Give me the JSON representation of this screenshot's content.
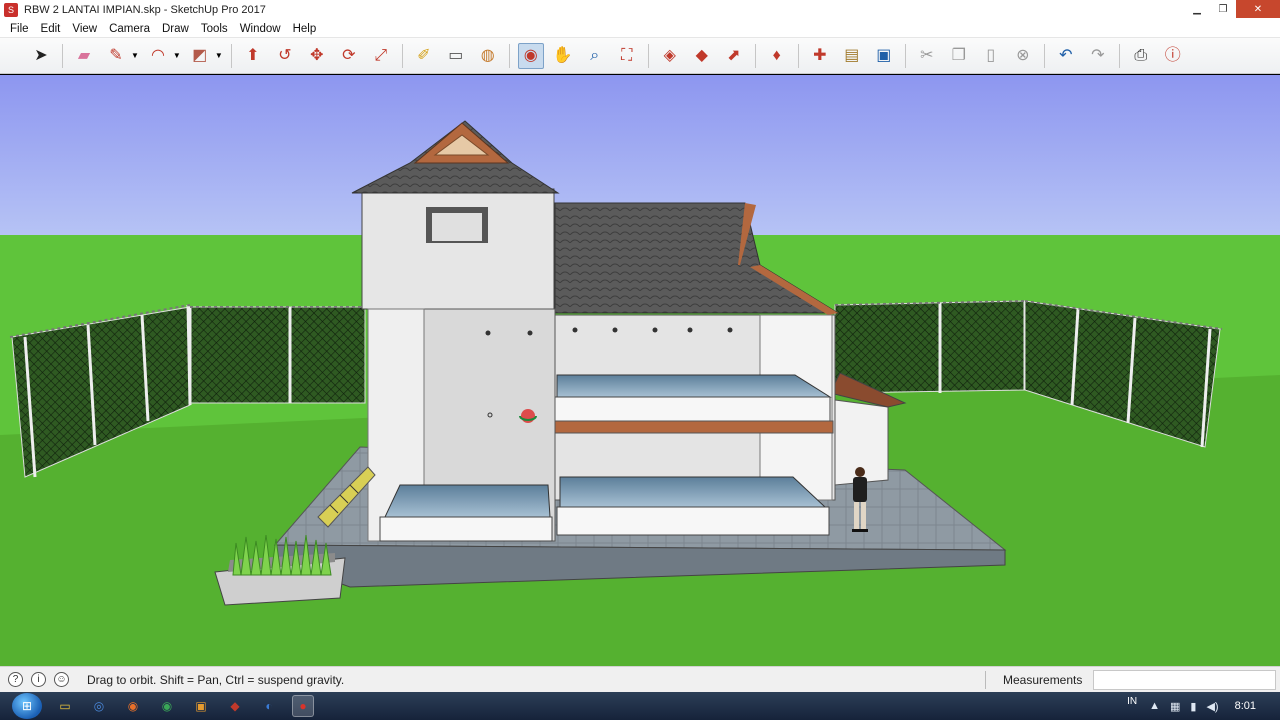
{
  "window": {
    "title": "RBW 2 LANTAI IMPIAN.skp - SketchUp Pro 2017",
    "app_icon": "sketchup-icon",
    "controls": [
      "minimize-icon",
      "maximize-icon",
      "close-icon"
    ]
  },
  "menu": {
    "items": [
      "File",
      "Edit",
      "View",
      "Camera",
      "Draw",
      "Tools",
      "Window",
      "Help"
    ]
  },
  "toolbar": {
    "tools": [
      {
        "name": "select-icon",
        "glyph": "➤",
        "color": "#222222"
      },
      {
        "name": "eraser-icon",
        "glyph": "▰",
        "color": "#d9739b"
      },
      {
        "name": "pencil-icon",
        "glyph": "✎",
        "color": "#c0392b"
      },
      {
        "name": "arc-icon",
        "glyph": "◠",
        "color": "#c0392b"
      },
      {
        "name": "rectangle-icon",
        "glyph": "◩",
        "color": "#b35a4a"
      },
      {
        "name": "push-pull-icon",
        "glyph": "⬆",
        "color": "#c0392b"
      },
      {
        "name": "follow-me-icon",
        "glyph": "↺",
        "color": "#c0392b"
      },
      {
        "name": "move-icon",
        "glyph": "✥",
        "color": "#c0392b"
      },
      {
        "name": "rotate-icon",
        "glyph": "⟳",
        "color": "#c0392b"
      },
      {
        "name": "scale-icon",
        "glyph": "⤢",
        "color": "#c0392b"
      },
      {
        "name": "tape-measure-icon",
        "glyph": "✐",
        "color": "#d4a017"
      },
      {
        "name": "text-icon",
        "glyph": "▭",
        "color": "#555555"
      },
      {
        "name": "paint-bucket-icon",
        "glyph": "◍",
        "color": "#c47a2c"
      },
      {
        "name": "orbit-icon",
        "glyph": "◉",
        "color": "#c0392b"
      },
      {
        "name": "pan-icon",
        "glyph": "✋",
        "color": "#d4a017"
      },
      {
        "name": "zoom-icon",
        "glyph": "⌕",
        "color": "#1f5fa8"
      },
      {
        "name": "zoom-extents-icon",
        "glyph": "⛶",
        "color": "#c0392b"
      },
      {
        "name": "warehouse-icon",
        "glyph": "◈",
        "color": "#c0392b"
      },
      {
        "name": "extension-icon",
        "glyph": "◆",
        "color": "#c0392b"
      },
      {
        "name": "share-model-icon",
        "glyph": "⬈",
        "color": "#c0392b"
      },
      {
        "name": "ruby-icon",
        "glyph": "♦",
        "color": "#c0392b"
      },
      {
        "name": "new-file-icon",
        "glyph": "✚",
        "color": "#c0392b"
      },
      {
        "name": "open-folder-icon",
        "glyph": "▤",
        "color": "#a07a2c"
      },
      {
        "name": "save-icon",
        "glyph": "▣",
        "color": "#1f5fa8"
      },
      {
        "name": "cut-icon",
        "glyph": "✂",
        "color": "#999999"
      },
      {
        "name": "copy-icon",
        "glyph": "❐",
        "color": "#999999"
      },
      {
        "name": "paste-icon",
        "glyph": "▯",
        "color": "#999999"
      },
      {
        "name": "delete-icon",
        "glyph": "⊗",
        "color": "#999999"
      },
      {
        "name": "undo-icon",
        "glyph": "↶",
        "color": "#1f5fa8"
      },
      {
        "name": "redo-icon",
        "glyph": "↷",
        "color": "#999999"
      },
      {
        "name": "print-icon",
        "glyph": "⎙",
        "color": "#333333"
      },
      {
        "name": "model-info-icon",
        "glyph": "ⓘ",
        "color": "#c0392b"
      }
    ],
    "active_tool": "orbit-icon"
  },
  "viewport": {
    "sky_color": "#8d96f0",
    "grass_color": "#5fc43b",
    "ground_color": "#4fa52a"
  },
  "status": {
    "message": "Drag to orbit. Shift = Pan, Ctrl = suspend gravity.",
    "measurements_label": "Measurements",
    "measurements_value": ""
  },
  "taskbar": {
    "apps": [
      {
        "name": "explorer-icon",
        "color": "#e8c23a"
      },
      {
        "name": "chrome-alt-icon",
        "color": "#4a89dc"
      },
      {
        "name": "firefox-icon",
        "color": "#e8702a"
      },
      {
        "name": "chrome-icon",
        "color": "#3aa657"
      },
      {
        "name": "photo-viewer-icon",
        "color": "#e59b2f"
      },
      {
        "name": "sketchup-icon",
        "color": "#c0392b"
      },
      {
        "name": "media-player-icon",
        "color": "#3a7bd5"
      },
      {
        "name": "screen-recorder-icon",
        "color": "#d9342b"
      }
    ],
    "active_app": "screen-recorder-icon",
    "language": "IN",
    "clock": "8:01"
  }
}
